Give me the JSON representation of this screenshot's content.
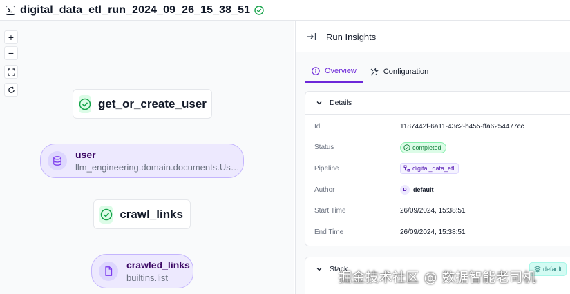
{
  "header": {
    "run_name": "digital_data_etl_run_2024_09_26_15_38_51"
  },
  "canvas": {
    "zoom_in": "+",
    "zoom_out": "−",
    "nodes": [
      {
        "kind": "step",
        "label": "get_or_create_user",
        "status": "completed"
      },
      {
        "kind": "artifact",
        "name": "user",
        "type": "llm_engineering.domain.documents.Use..."
      },
      {
        "kind": "step",
        "label": "crawl_links",
        "status": "completed"
      },
      {
        "kind": "artifact",
        "name": "crawled_links",
        "type": "builtins.list"
      }
    ]
  },
  "panel": {
    "title": "Run Insights",
    "tabs": [
      {
        "label": "Overview",
        "active": true
      },
      {
        "label": "Configuration",
        "active": false
      }
    ],
    "details": {
      "section_title": "Details",
      "rows": [
        {
          "label": "Id",
          "value": "1187442f-6a11-43c2-b455-ffa6254477cc"
        },
        {
          "label": "Status",
          "value": "completed"
        },
        {
          "label": "Pipeline",
          "value": "digital_data_etl"
        },
        {
          "label": "Author",
          "avatar": "D",
          "value": "default"
        },
        {
          "label": "Start Time",
          "value": "26/09/2024, 15:38:51"
        },
        {
          "label": "End Time",
          "value": "26/09/2024, 15:38:51"
        }
      ]
    },
    "stack": {
      "section_title": "Stack",
      "chip": "default"
    }
  },
  "watermark": "掘金技术社区 @ 数据智能老司机",
  "colors": {
    "accent": "#6d28d9",
    "success": "#16a34a",
    "artifact_bg": "#ede9fe"
  }
}
